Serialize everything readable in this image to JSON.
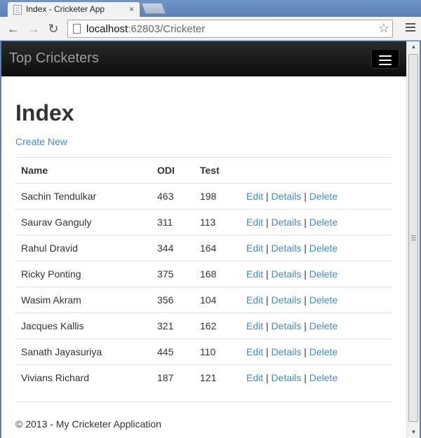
{
  "browser": {
    "tab_title": "Index - Cricketer App",
    "tab_close": "×",
    "url_host": "localhost",
    "url_rest": ":62803/Cricketer"
  },
  "navbar": {
    "brand": "Top Cricketers"
  },
  "page": {
    "heading": "Index",
    "create_new": "Create New",
    "columns": {
      "name": "Name",
      "odi": "ODI",
      "test": "Test"
    },
    "actions": {
      "edit": "Edit",
      "details": "Details",
      "delete": "Delete",
      "separator": "|"
    },
    "rows": [
      {
        "name": "Sachin Tendulkar",
        "odi": "463",
        "test": "198"
      },
      {
        "name": "Saurav Ganguly",
        "odi": "311",
        "test": "113"
      },
      {
        "name": "Rahul Dravid",
        "odi": "344",
        "test": "164"
      },
      {
        "name": "Ricky Ponting",
        "odi": "375",
        "test": "168"
      },
      {
        "name": "Wasim Akram",
        "odi": "356",
        "test": "104"
      },
      {
        "name": "Jacques Kallis",
        "odi": "321",
        "test": "162"
      },
      {
        "name": "Sanath Jayasuriya",
        "odi": "445",
        "test": "110"
      },
      {
        "name": "Vivians Richard",
        "odi": "187",
        "test": "121"
      }
    ],
    "footer": "© 2013 - My Cricketer Application"
  },
  "icons": {
    "back": "back-arrow-icon",
    "forward": "forward-arrow-icon",
    "reload": "reload-icon",
    "star": "bookmark-star-icon",
    "menu": "hamburger-menu-icon"
  },
  "colors": {
    "link": "#428bca",
    "navbar": "#222222",
    "brand": "#9d9d9d"
  }
}
